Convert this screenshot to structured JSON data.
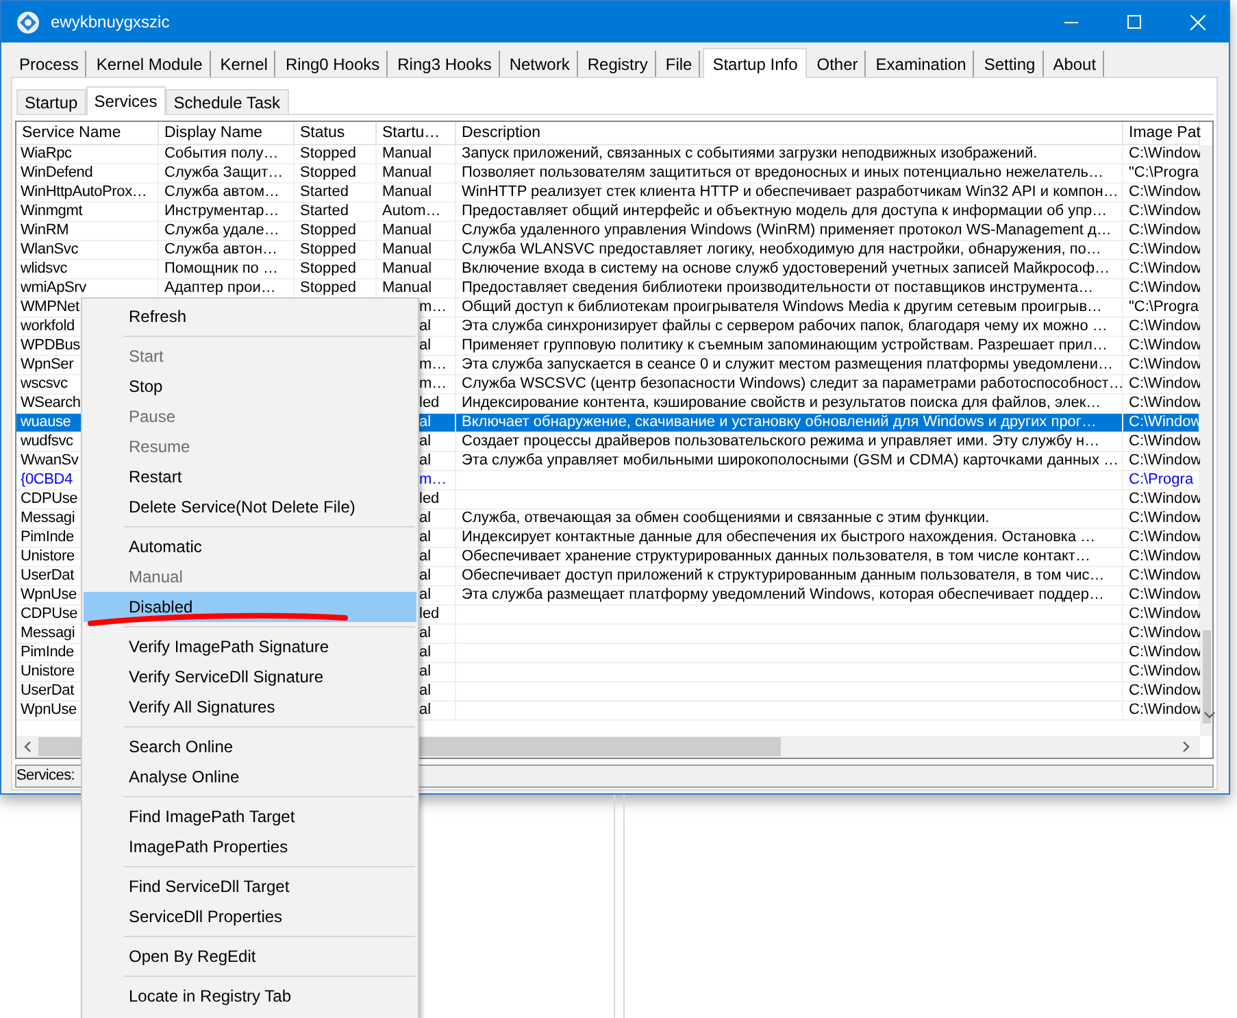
{
  "window": {
    "title": "ewykbnuygxszic"
  },
  "tabs": [
    {
      "label": "Process",
      "selected": false
    },
    {
      "label": "Kernel Module",
      "selected": false
    },
    {
      "label": "Kernel",
      "selected": false
    },
    {
      "label": "Ring0 Hooks",
      "selected": false
    },
    {
      "label": "Ring3 Hooks",
      "selected": false
    },
    {
      "label": "Network",
      "selected": false
    },
    {
      "label": "Registry",
      "selected": false
    },
    {
      "label": "File",
      "selected": false
    },
    {
      "label": "Startup Info",
      "selected": true
    },
    {
      "label": "Other",
      "selected": false
    },
    {
      "label": "Examination",
      "selected": false
    },
    {
      "label": "Setting",
      "selected": false
    },
    {
      "label": "About",
      "selected": false
    }
  ],
  "subtabs": [
    {
      "label": "Startup",
      "selected": false
    },
    {
      "label": "Services",
      "selected": true
    },
    {
      "label": "Schedule Task",
      "selected": false
    }
  ],
  "table": {
    "columns": [
      "Service Name",
      "Display Name",
      "Status",
      "Startu…",
      "Description",
      "Image Pat"
    ],
    "rows": [
      {
        "service_name": "WiaRpc",
        "display_name": "События полу…",
        "status": "Stopped",
        "startup": "Manual",
        "description": "Запуск приложений, связанных с событиями загрузки неподвижных изображений.",
        "image_path": "C:\\Window",
        "selected": false,
        "color": "#000000"
      },
      {
        "service_name": "WinDefend",
        "display_name": "Служба Защит…",
        "status": "Stopped",
        "startup": "Manual",
        "description": "Позволяет пользователям защититься от вредоносных и иных потенциально нежелатель…",
        "image_path": "\"C:\\Progra",
        "selected": false,
        "color": "#000000"
      },
      {
        "service_name": "WinHttpAutoProx…",
        "display_name": "Служба автом…",
        "status": "Started",
        "startup": "Manual",
        "description": "WinHTTP реализует стек клиента HTTP и обеспечивает разработчикам Win32 API и компон…",
        "image_path": "C:\\Window",
        "selected": false,
        "color": "#000000"
      },
      {
        "service_name": "Winmgmt",
        "display_name": "Инструментар…",
        "status": "Started",
        "startup": "Autom…",
        "description": "Предоставляет общий интерфейс и объектную модель для доступа к информации об упр…",
        "image_path": "C:\\Window",
        "selected": false,
        "color": "#000000"
      },
      {
        "service_name": "WinRM",
        "display_name": "Служба удале…",
        "status": "Stopped",
        "startup": "Manual",
        "description": "Служба удаленного управления Windows (WinRM) применяет протокол WS-Management д…",
        "image_path": "C:\\Window",
        "selected": false,
        "color": "#000000"
      },
      {
        "service_name": "WlanSvc",
        "display_name": "Служба автон…",
        "status": "Stopped",
        "startup": "Manual",
        "description": "Служба WLANSVC предоставляет логику, необходимую для настройки, обнаружения, по…",
        "image_path": "C:\\Window",
        "selected": false,
        "color": "#000000"
      },
      {
        "service_name": "wlidsvc",
        "display_name": "Помощник по …",
        "status": "Stopped",
        "startup": "Manual",
        "description": "Включение входа в систему на основе служб удостоверений учетных записей Майкрософ…",
        "image_path": "C:\\Window",
        "selected": false,
        "color": "#000000"
      },
      {
        "service_name": "wmiApSrv",
        "display_name": "Адаптер прои…",
        "status": "Stopped",
        "startup": "Manual",
        "description": "Предоставляет сведения библиотеки производительности от поставщиков инструмента…",
        "image_path": "C:\\Window",
        "selected": false,
        "color": "#000000"
      },
      {
        "service_name": "WMPNet",
        "startup": "m…",
        "description": "Общий доступ к библиотекам проигрывателя Windows Media к другим сетевым проигрыв…",
        "image_path": "\"C:\\Progra",
        "selected": false,
        "color": "#000000"
      },
      {
        "service_name": "workfold",
        "startup": "al",
        "description": "Эта служба синхронизирует файлы с сервером рабочих папок, благодаря чему их можно …",
        "image_path": "C:\\Window",
        "selected": false,
        "color": "#000000"
      },
      {
        "service_name": "WPDBus",
        "startup": "al",
        "description": "Применяет групповую политику к съемным запоминающим устройствам. Разрешает прил…",
        "image_path": "C:\\Window",
        "selected": false,
        "color": "#000000"
      },
      {
        "service_name": "WpnSer",
        "startup": "m…",
        "description": "Эта служба запускается в сеансе 0 и служит местом размещения платформы уведомлени…",
        "image_path": "C:\\Window",
        "selected": false,
        "color": "#000000"
      },
      {
        "service_name": "wscsvc",
        "startup": "m…",
        "description": "Служба WSCSVC (центр безопасности Windows) следит за параметрами работоспособност…",
        "image_path": "C:\\Window",
        "selected": false,
        "color": "#000000"
      },
      {
        "service_name": "WSearch",
        "startup": "led",
        "description": "Индексирование контента, кэширование свойств и результатов поиска для файлов, элек…",
        "image_path": "C:\\Window",
        "selected": false,
        "color": "#000000"
      },
      {
        "service_name": "wuause",
        "startup": "al",
        "description": "Включает обнаружение, скачивание и установку обновлений для Windows и других прог…",
        "image_path": "C:\\Window",
        "selected": true
      },
      {
        "service_name": "wudfsvc",
        "startup": "al",
        "description": "Создает процессы драйверов пользовательского режима и управляет ими. Эту службу н…",
        "image_path": "C:\\Window",
        "selected": false,
        "color": "#000000"
      },
      {
        "service_name": "WwanSv",
        "startup": "al",
        "description": "Эта служба управляет мобильными широкополосными (GSM и CDMA) карточками данных …",
        "image_path": "C:\\Window",
        "selected": false,
        "color": "#000000"
      },
      {
        "service_name": "{0CBD4",
        "startup": "m…",
        "image_path": "C:\\Progra",
        "selected": false,
        "color": "#0000ff"
      },
      {
        "service_name": "CDPUse",
        "startup": "led",
        "image_path": "C:\\Window",
        "selected": false,
        "color": "#000000"
      },
      {
        "service_name": "Messagi",
        "startup": "al",
        "description": "Служба, отвечающая за обмен сообщениями и связанные с этим функции.",
        "image_path": "C:\\Window",
        "selected": false,
        "color": "#000000"
      },
      {
        "service_name": "PimInde",
        "startup": "al",
        "description": "Индексирует контактные данные для обеспечения их быстрого нахождения. Остановка …",
        "image_path": "C:\\Window",
        "selected": false,
        "color": "#000000"
      },
      {
        "service_name": "Unistore",
        "startup": "al",
        "description": "Обеспечивает хранение структурированных данных пользователя, в том числе контакт…",
        "image_path": "C:\\Window",
        "selected": false,
        "color": "#000000"
      },
      {
        "service_name": "UserDat",
        "startup": "al",
        "description": "Обеспечивает доступ приложений к структурированным данным пользователя, в том чис…",
        "image_path": "C:\\Window",
        "selected": false,
        "color": "#000000"
      },
      {
        "service_name": "WpnUse",
        "startup": "al",
        "description": "Эта служба размещает платформу уведомлений Windows, которая обеспечивает поддер…",
        "image_path": "C:\\Window",
        "selected": false,
        "color": "#000000"
      },
      {
        "service_name": "CDPUse",
        "startup": "led",
        "image_path": "C:\\Window",
        "selected": false,
        "color": "#000000"
      },
      {
        "service_name": "Messagi",
        "startup": "al",
        "image_path": "C:\\Window",
        "selected": false,
        "color": "#000000"
      },
      {
        "service_name": "PimInde",
        "startup": "al",
        "image_path": "C:\\Window",
        "selected": false,
        "color": "#000000"
      },
      {
        "service_name": "Unistore",
        "startup": "al",
        "image_path": "C:\\Window",
        "selected": false,
        "color": "#000000"
      },
      {
        "service_name": "UserDat",
        "startup": "al",
        "image_path": "C:\\Window",
        "selected": false,
        "color": "#000000"
      },
      {
        "service_name": "WpnUse",
        "startup": "al",
        "image_path": "C:\\Window",
        "selected": false,
        "color": "#000000"
      }
    ]
  },
  "status_bar": {
    "label": "Services:"
  },
  "context_menu": {
    "items": [
      {
        "kind": "item",
        "label": "Refresh",
        "disabled": false,
        "selected": false
      },
      {
        "kind": "separator"
      },
      {
        "kind": "item",
        "label": "Start",
        "disabled": true,
        "selected": false
      },
      {
        "kind": "item",
        "label": "Stop",
        "disabled": false,
        "selected": false
      },
      {
        "kind": "item",
        "label": "Pause",
        "disabled": true,
        "selected": false
      },
      {
        "kind": "item",
        "label": "Resume",
        "disabled": true,
        "selected": false
      },
      {
        "kind": "item",
        "label": "Restart",
        "disabled": false,
        "selected": false
      },
      {
        "kind": "item",
        "label": "Delete Service(Not Delete File)",
        "disabled": false,
        "selected": false
      },
      {
        "kind": "separator"
      },
      {
        "kind": "item",
        "label": "Automatic",
        "disabled": false,
        "selected": false
      },
      {
        "kind": "item",
        "label": "Manual",
        "disabled": true,
        "selected": false
      },
      {
        "kind": "item",
        "label": "Disabled",
        "disabled": false,
        "selected": true
      },
      {
        "kind": "separator"
      },
      {
        "kind": "item",
        "label": "Verify ImagePath Signature",
        "disabled": false,
        "selected": false
      },
      {
        "kind": "item",
        "label": "Verify ServiceDll Signature",
        "disabled": false,
        "selected": false
      },
      {
        "kind": "item",
        "label": "Verify All Signatures",
        "disabled": false,
        "selected": false
      },
      {
        "kind": "separator"
      },
      {
        "kind": "item",
        "label": "Search Online",
        "disabled": false,
        "selected": false
      },
      {
        "kind": "item",
        "label": "Analyse Online",
        "disabled": false,
        "selected": false
      },
      {
        "kind": "separator"
      },
      {
        "kind": "item",
        "label": "Find ImagePath Target",
        "disabled": false,
        "selected": false
      },
      {
        "kind": "item",
        "label": "ImagePath Properties",
        "disabled": false,
        "selected": false
      },
      {
        "kind": "separator"
      },
      {
        "kind": "item",
        "label": "Find ServiceDll Target",
        "disabled": false,
        "selected": false
      },
      {
        "kind": "item",
        "label": "ServiceDll Properties",
        "disabled": false,
        "selected": false
      },
      {
        "kind": "separator"
      },
      {
        "kind": "item",
        "label": "Open By RegEdit",
        "disabled": false,
        "selected": false
      },
      {
        "kind": "separator"
      },
      {
        "kind": "item",
        "label": "Locate in Registry Tab",
        "disabled": false,
        "selected": false
      }
    ]
  }
}
